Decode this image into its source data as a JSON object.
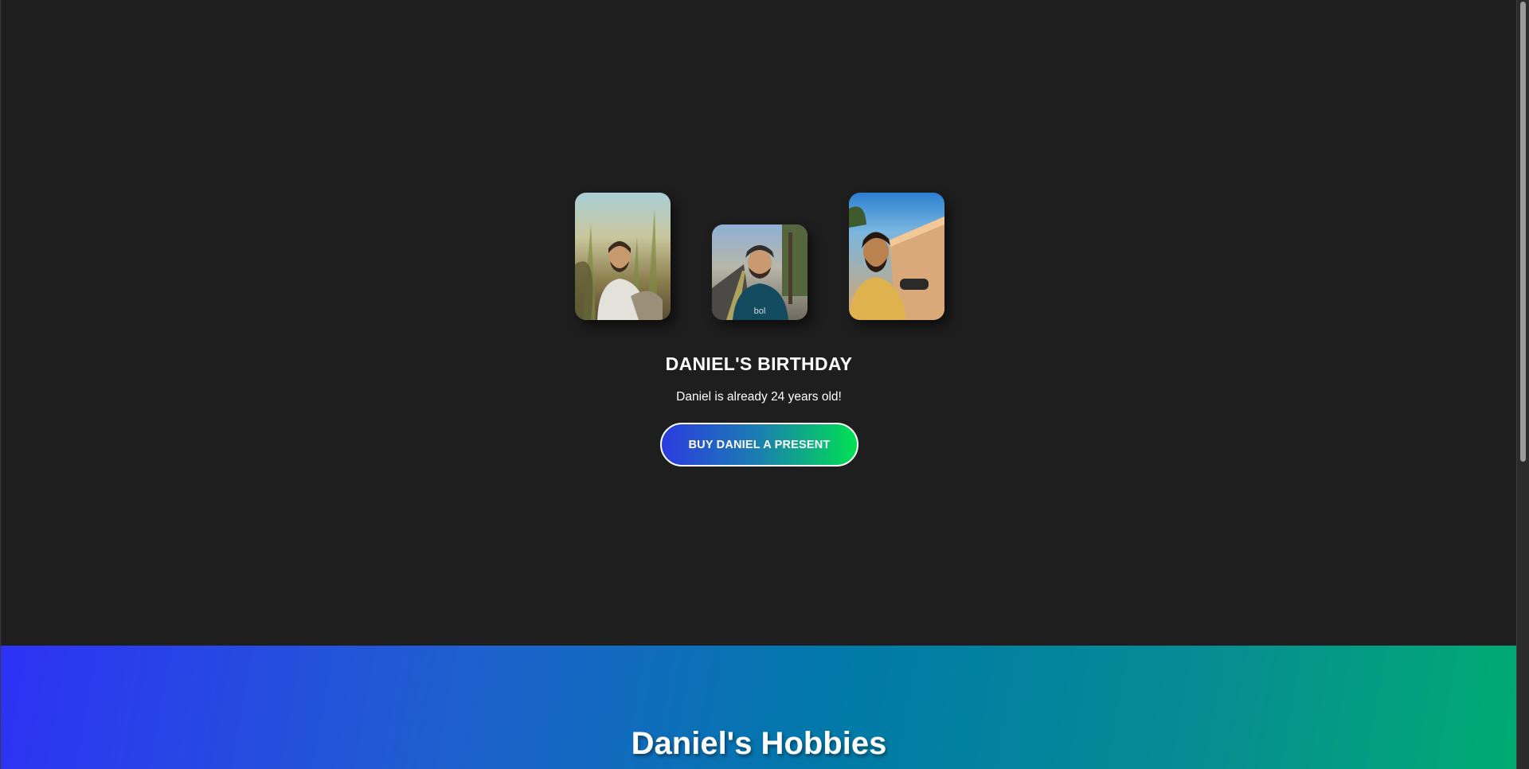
{
  "hero": {
    "photos": [
      {
        "name": "daniel-photo-field"
      },
      {
        "name": "daniel-photo-street"
      },
      {
        "name": "daniel-photo-wall"
      }
    ],
    "title": "DANIEL'S BIRTHDAY",
    "subtitle": "Daniel is already 24 years old!",
    "cta_label": "BUY DANIEL A PRESENT"
  },
  "hobbies": {
    "title": "Daniel's Hobbies"
  },
  "colors": {
    "background": "#1e1e1e",
    "button_gradient_start": "#2b3be0",
    "button_gradient_end": "#00e052",
    "hobbies_gradient_start": "#2d32f5",
    "hobbies_gradient_end": "#00ab72"
  }
}
